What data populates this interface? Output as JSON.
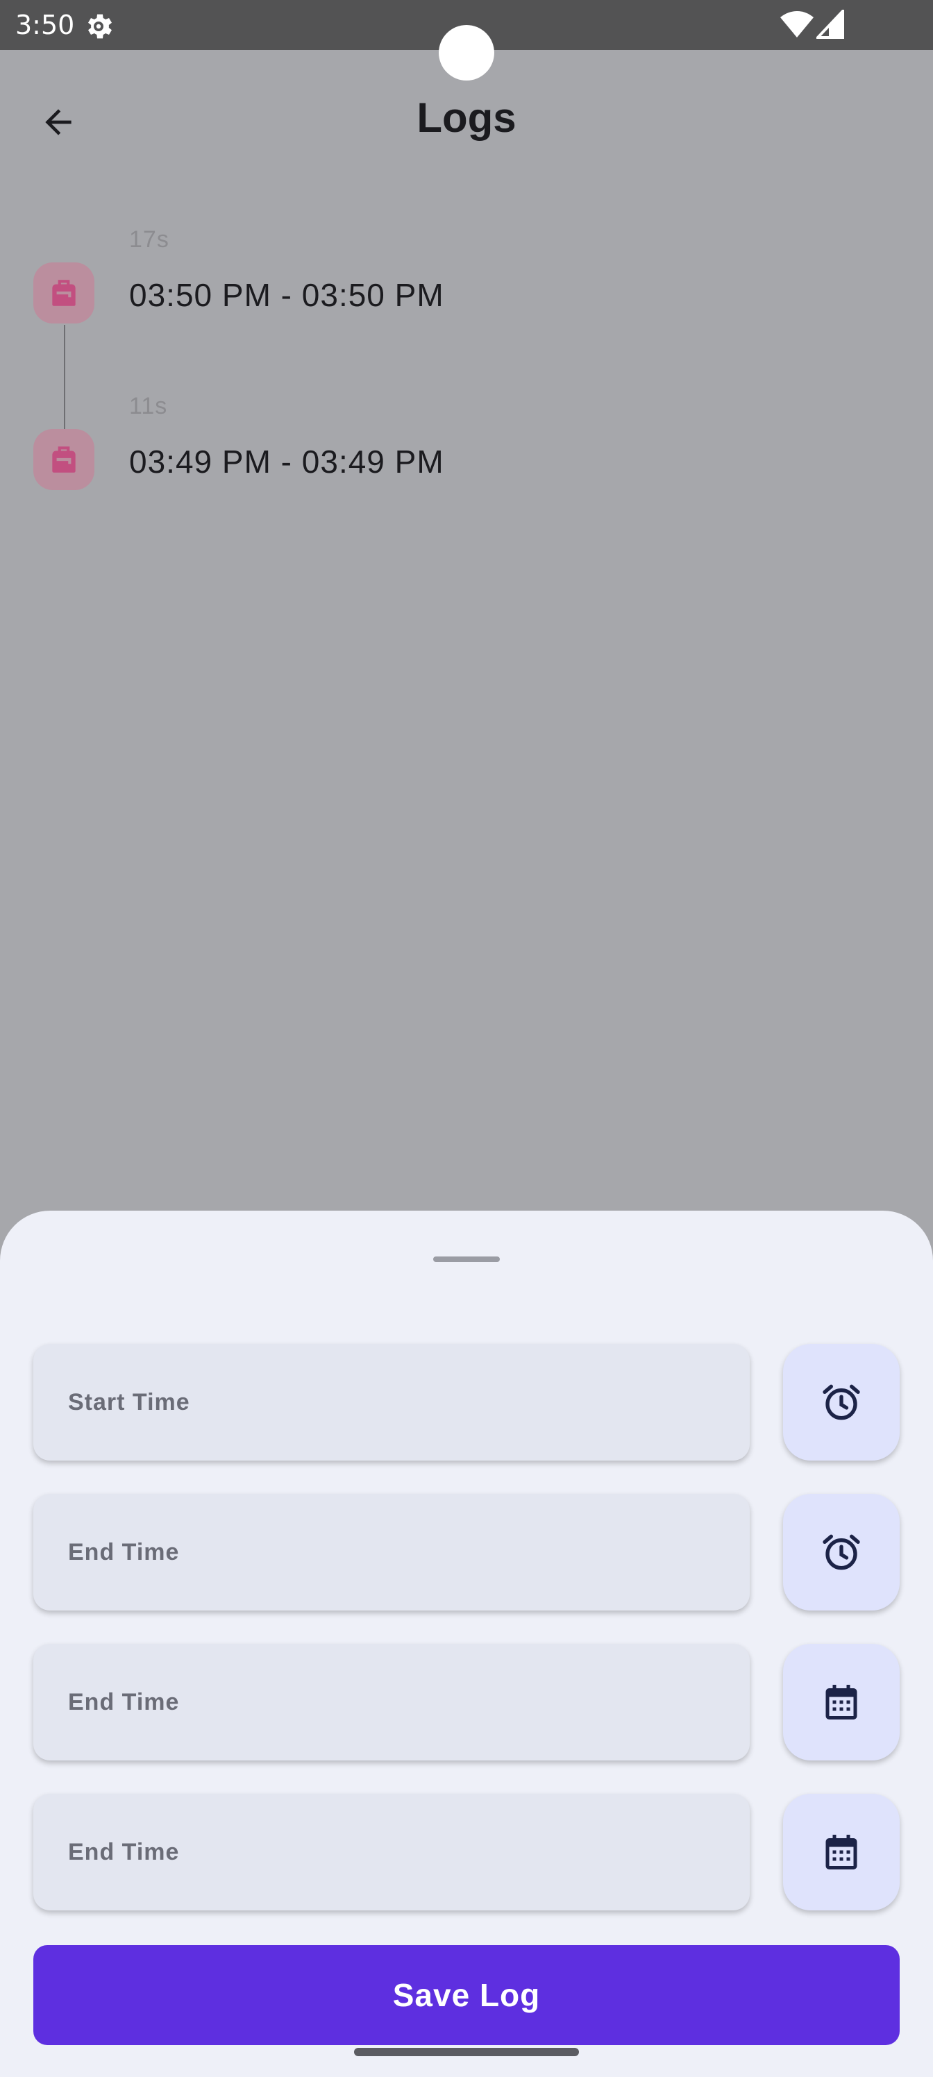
{
  "status_bar": {
    "time": "3:50",
    "icons": [
      "gear-icon",
      "wifi-icon",
      "signal-icon"
    ]
  },
  "app_bar": {
    "back_icon": "arrow-back-icon",
    "title": "Logs"
  },
  "logs": [
    {
      "duration": "17s",
      "range": "03:50 PM - 03:50 PM",
      "icon": "backpack-icon"
    },
    {
      "duration": "11s",
      "range": "03:49 PM - 03:49 PM",
      "icon": "backpack-icon"
    }
  ],
  "sheet": {
    "fields": [
      {
        "label": "Start Time",
        "picker_icon": "alarm-clock-icon"
      },
      {
        "label": "End Time",
        "picker_icon": "alarm-clock-icon"
      },
      {
        "label": "End Time",
        "picker_icon": "calendar-icon"
      },
      {
        "label": "End Time",
        "picker_icon": "calendar-icon"
      }
    ],
    "save_label": "Save Log"
  },
  "colors": {
    "scrim": "#a6a7ab",
    "sheet_bg": "#eef0f8",
    "primary": "#5e2fe0",
    "field_bg": "#e3e6f0",
    "picker_bg": "#dfe3fc",
    "log_icon": "#c24f80"
  }
}
